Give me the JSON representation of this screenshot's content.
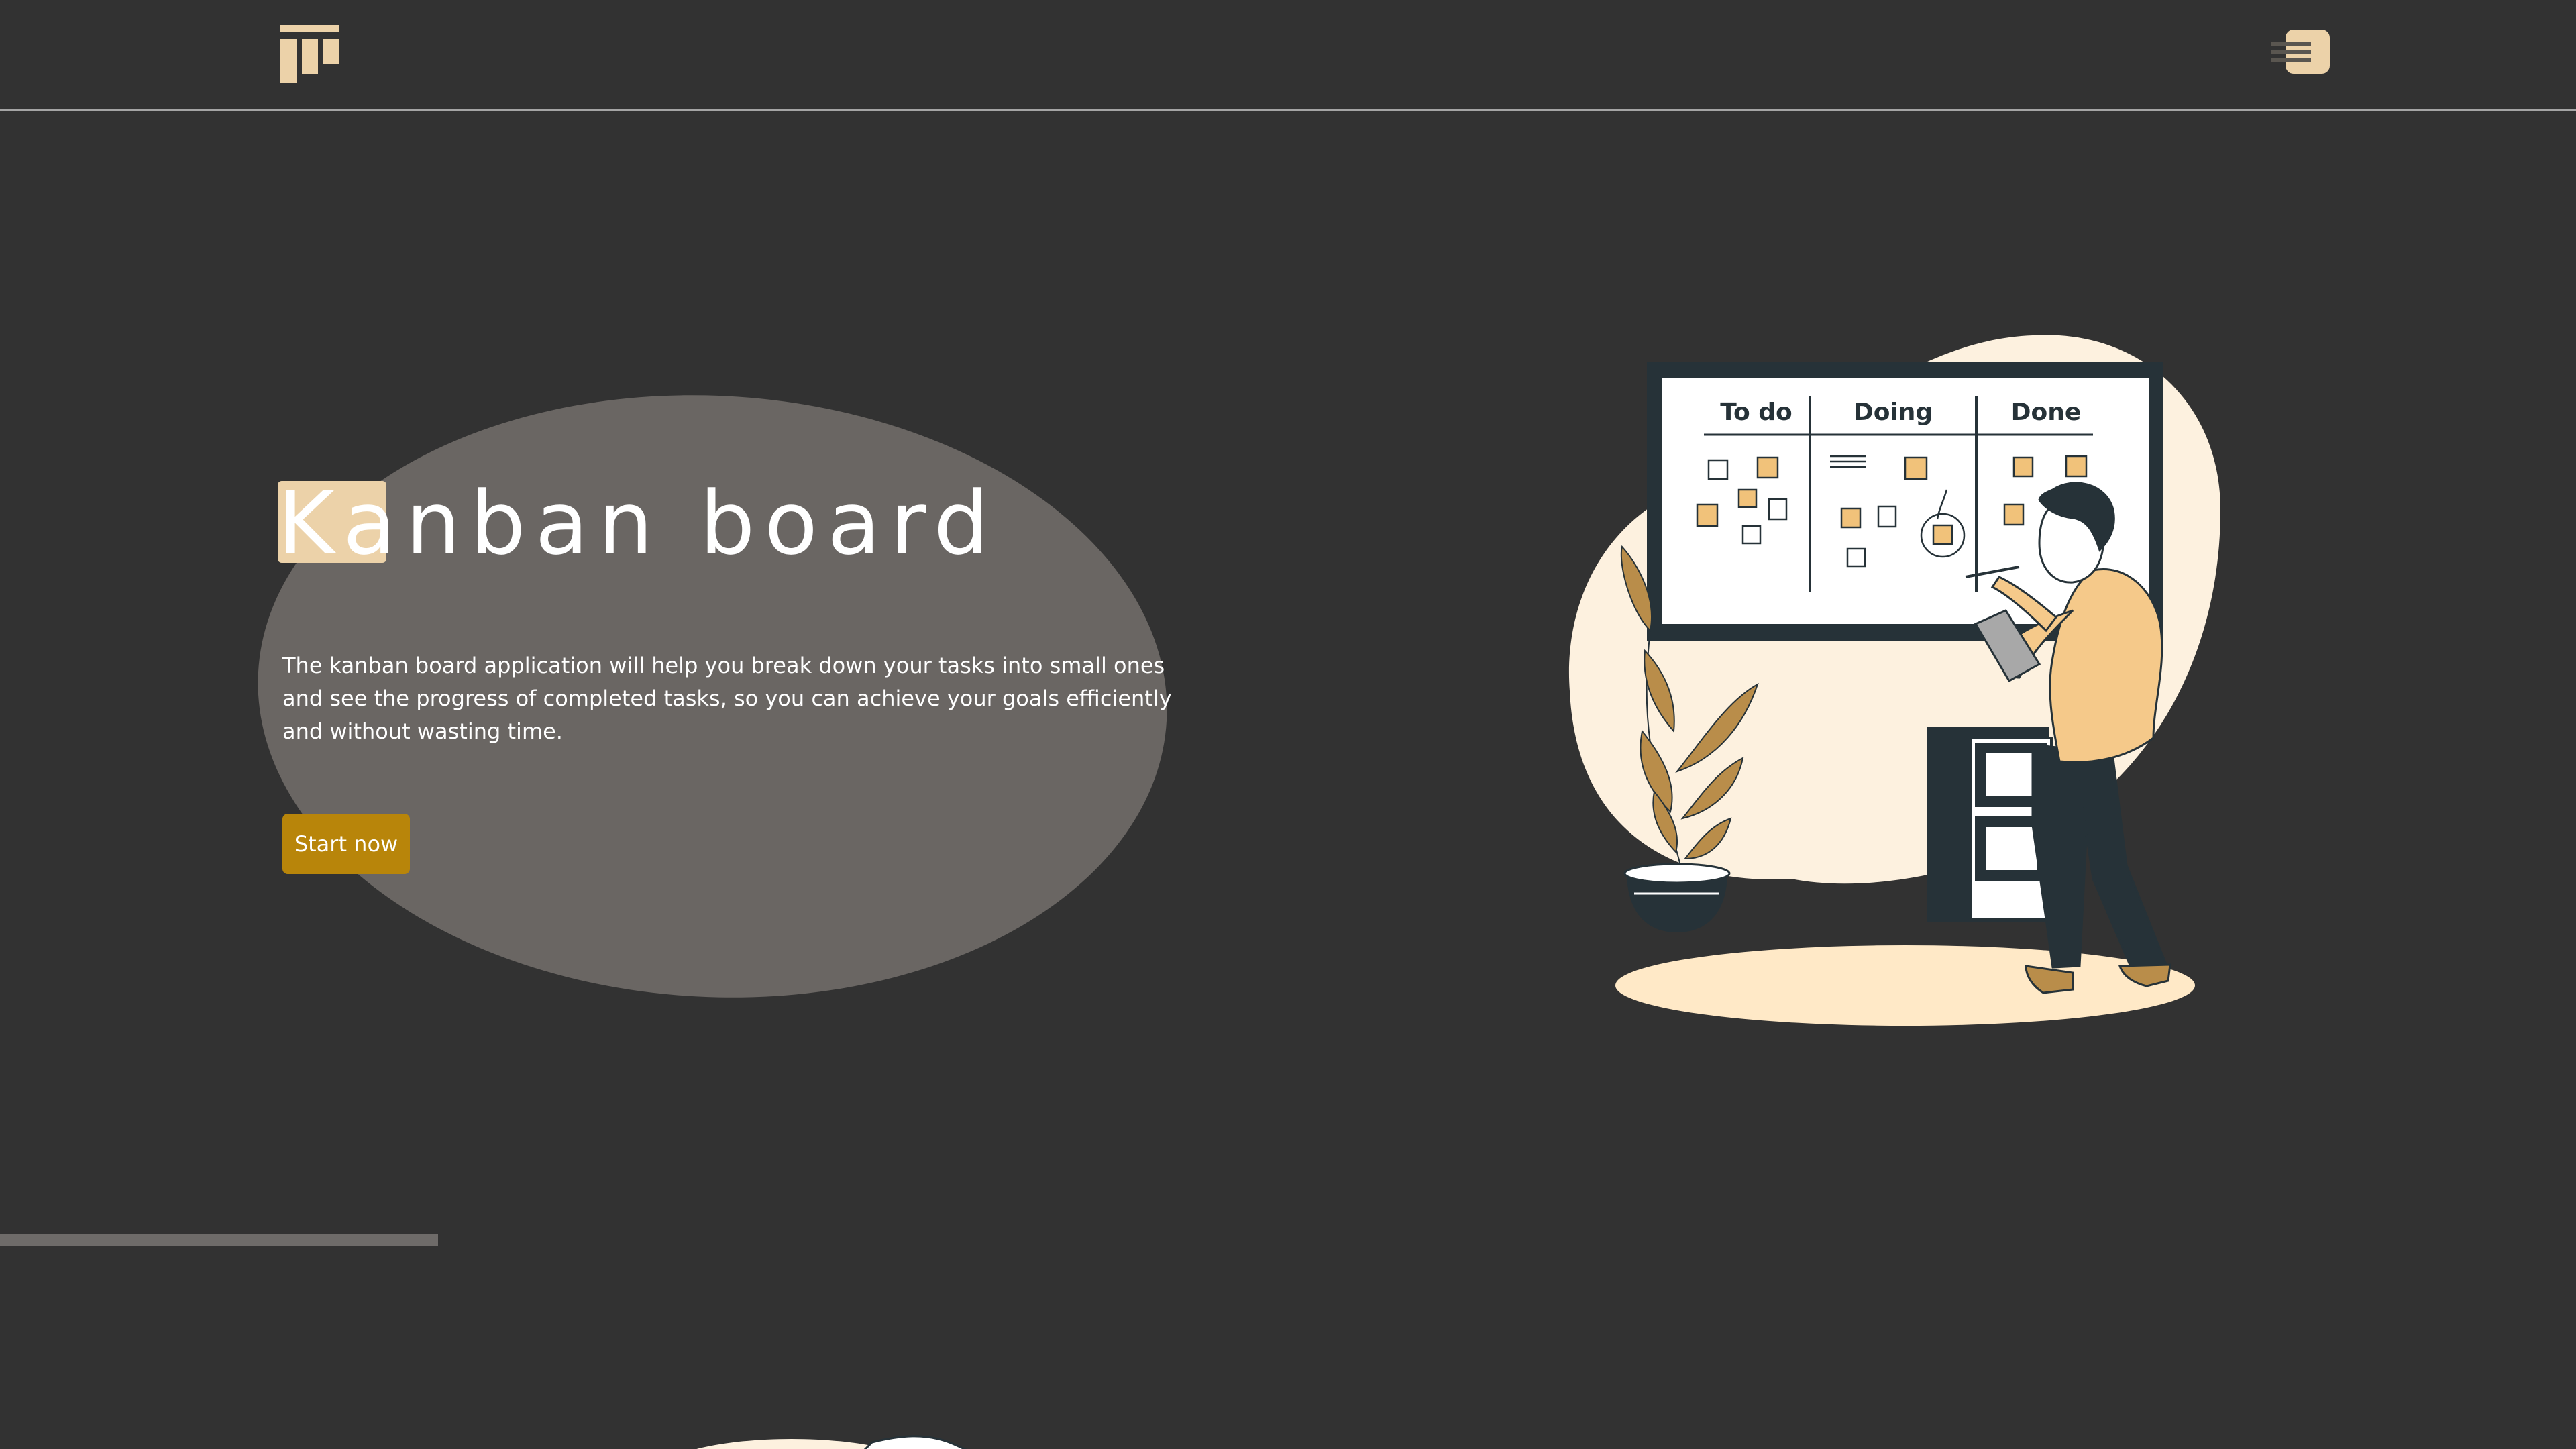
{
  "header": {
    "logo_icon": "kanban-logo-icon",
    "menu_icon": "hamburger-menu-icon"
  },
  "hero": {
    "title": "Kanban board",
    "description": "The kanban board application will help you break down your tasks into small ones and see the progress of completed tasks, so you can achieve your goals efficiently and without wasting time.",
    "cta_label": "Start now"
  },
  "illustration": {
    "columns": [
      "To do",
      "Doing",
      "Done"
    ]
  },
  "colors": {
    "background": "#323232",
    "accent_beige": "#ecd2a9",
    "button": "#b8850a",
    "blob": "#6a6663",
    "board_dark": "#263238"
  },
  "scroll_progress": 0.17
}
